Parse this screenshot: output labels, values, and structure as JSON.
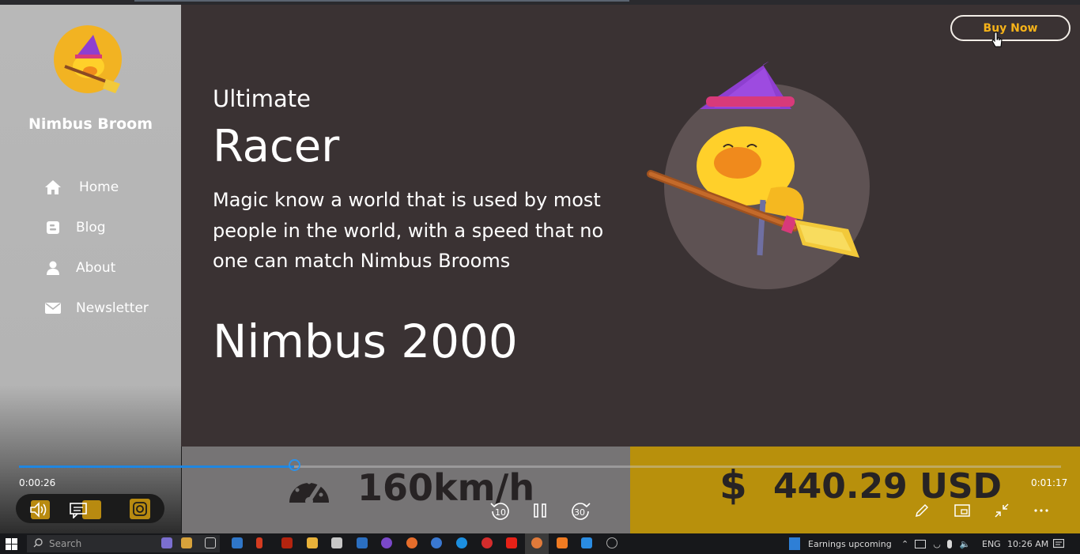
{
  "sidebar": {
    "brand": "Nimbus Broom",
    "items": [
      {
        "label": "Home",
        "icon": "home-icon"
      },
      {
        "label": "Blog",
        "icon": "blogger-icon"
      },
      {
        "label": "About",
        "icon": "user-icon"
      },
      {
        "label": "Newsletter",
        "icon": "envelope-icon"
      }
    ]
  },
  "header": {
    "buy_label": "Buy Now"
  },
  "hero": {
    "kicker": "Ultimate",
    "title": "Racer",
    "description": "Magic know a world that is used by most people in the world, with a speed that no one can match Nimbus Brooms",
    "model": "Nimbus 2000"
  },
  "stats": {
    "speed": "160km/h",
    "currency_symbol": "$",
    "price": "440.29 USD"
  },
  "player": {
    "elapsed": "0:00:26",
    "total": "0:01:17",
    "progress": 0.264,
    "skip_back": "10",
    "skip_forward": "30"
  },
  "taskbar": {
    "search_placeholder": "Search",
    "news_label": "Earnings upcoming",
    "language": "ENG",
    "clock": "10:26 AM"
  },
  "colors": {
    "accent": "#f6b319",
    "band_gold": "#b8900c",
    "main_bg": "#3a3233",
    "progress_blue": "#1f86e0"
  }
}
